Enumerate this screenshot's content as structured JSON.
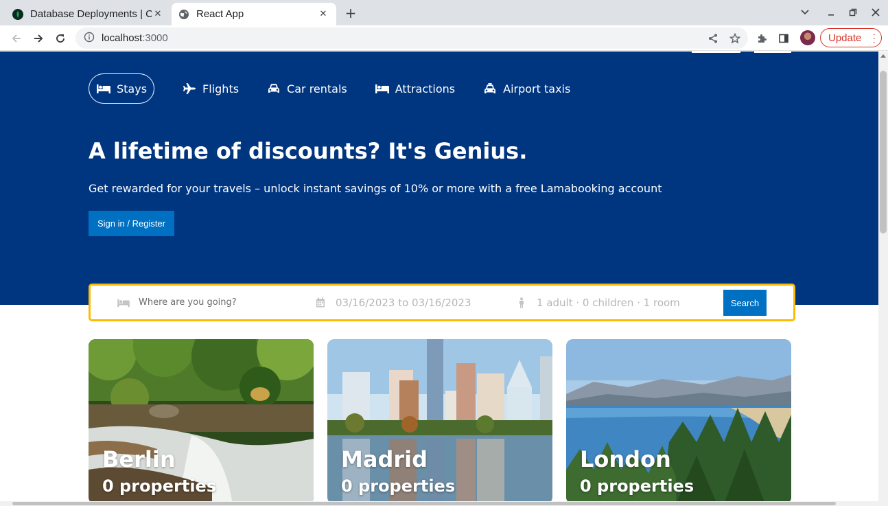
{
  "browser": {
    "tabs": [
      {
        "title": "Database Deployments | C",
        "active": false,
        "icon": "mongodb-leaf-icon"
      },
      {
        "title": "React App",
        "active": true,
        "icon": "globe-icon"
      }
    ],
    "url_host": "localhost",
    "url_port": ":3000",
    "update_label": "Update"
  },
  "nav": {
    "items": [
      {
        "label": "Stays",
        "icon": "bed-icon",
        "active": true
      },
      {
        "label": "Flights",
        "icon": "plane-icon",
        "active": false
      },
      {
        "label": "Car rentals",
        "icon": "car-icon",
        "active": false
      },
      {
        "label": "Attractions",
        "icon": "bed-icon",
        "active": false
      },
      {
        "label": "Airport taxis",
        "icon": "taxi-icon",
        "active": false
      }
    ]
  },
  "hero": {
    "title": "A lifetime of discounts? It's Genius.",
    "description": "Get rewarded for your travels – unlock instant savings of 10% or more with a free Lamabooking account",
    "signin_label": "Sign in / Register"
  },
  "search": {
    "destination_placeholder": "Where are you going?",
    "dates": "03/16/2023 to 03/16/2023",
    "guests": "1 adult · 0 children · 1 room",
    "button_label": "Search"
  },
  "featured": [
    {
      "city": "Berlin",
      "properties": "0 properties"
    },
    {
      "city": "Madrid",
      "properties": "0 properties"
    },
    {
      "city": "London",
      "properties": "0 properties"
    }
  ],
  "colors": {
    "brand_blue": "#003580",
    "button_blue": "#0071c2",
    "search_border": "#febb02"
  }
}
